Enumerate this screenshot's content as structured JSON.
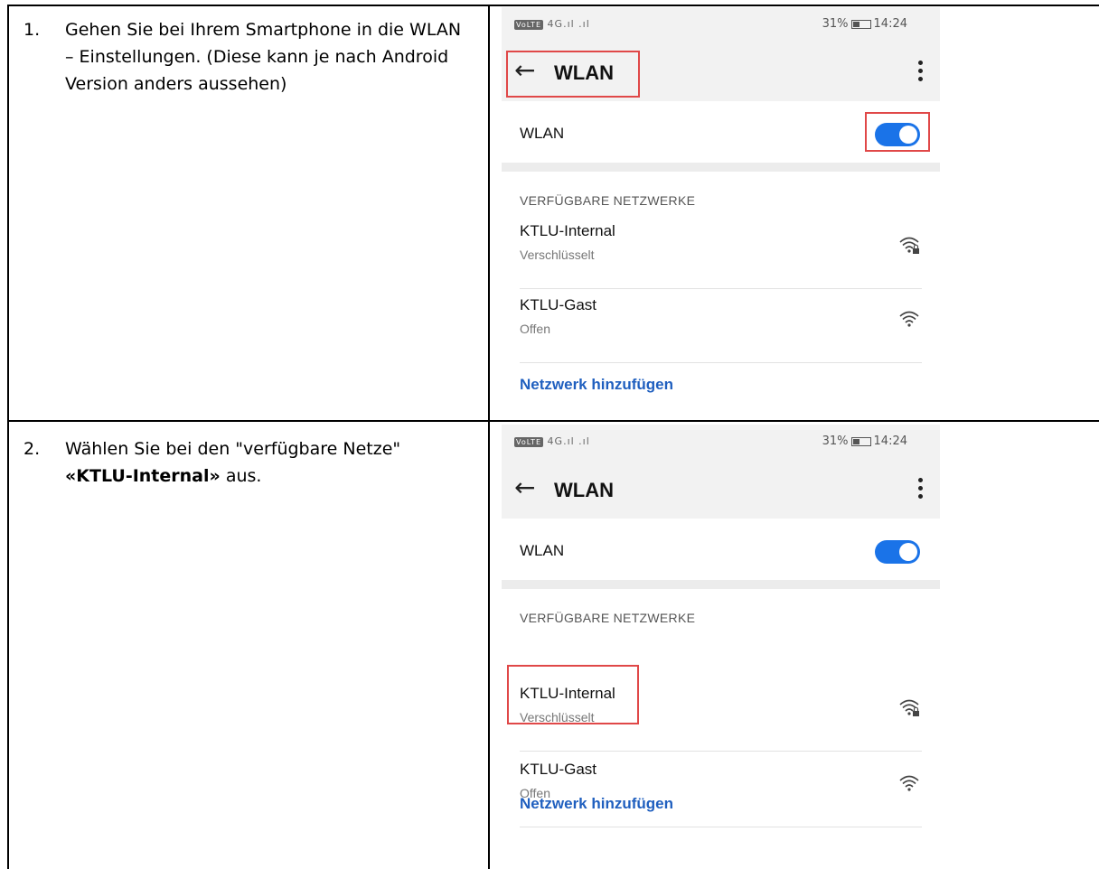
{
  "steps": [
    {
      "number": "1.",
      "text": "Gehen Sie bei Ihrem Smartphone in die WLAN – Einstellungen. (Diese kann je nach Android Version anders aussehen)"
    },
    {
      "number": "2.",
      "text_before": "Wählen Sie bei den \"verfügbare Netze\"",
      "text_bold": "«KTLU-Internal»",
      "text_after": " aus."
    }
  ],
  "phone": {
    "status_left": "4G",
    "volte": "VoLTE",
    "battery_percent": "31%",
    "time": "14:24",
    "title": "WLAN",
    "wlan_label": "WLAN",
    "wlan_enabled": true,
    "section_header": "VERFÜGBARE NETZWERKE",
    "networks": [
      {
        "name": "KTLU-Internal",
        "status": "Verschlüsselt",
        "icon": "wifi-lock-icon"
      },
      {
        "name": "KTLU-Gast",
        "status": "Offen",
        "icon": "wifi-icon"
      }
    ],
    "add_network": "Netzwerk hinzufügen",
    "accent_color": "#1a73e8",
    "highlight_color": "#e04848"
  }
}
